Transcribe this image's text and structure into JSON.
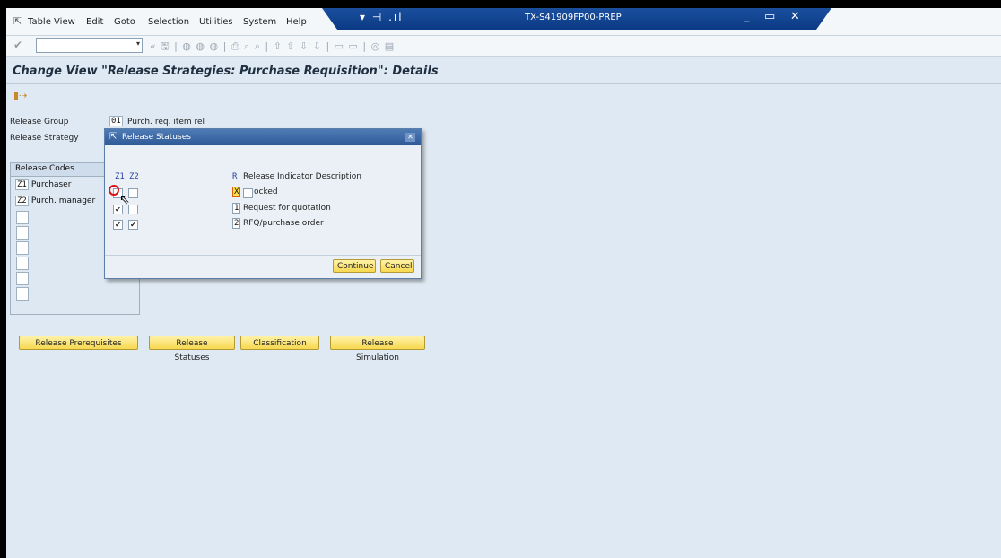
{
  "menubar": {
    "items": [
      "Table View",
      "Edit",
      "Goto",
      "Selection",
      "Utilities",
      "System",
      "Help"
    ],
    "system_name": "TX-S41909FP00-PREP",
    "banner_icons": "▾ ⊣ .ıl",
    "window_controls": "_ ▭ ✕"
  },
  "toolbar": {
    "command_value": "",
    "dropdown_glyph": "▾",
    "icons_glyphs": "« 🖫 | ◍ ◍ ◍ | ⎙ ⌕ ⌕ | ⇧ ⇧ ⇩ ⇩ | ▭ ▭ | ◎ ▤"
  },
  "screen": {
    "title": "Change View \"Release Strategies: Purchase Requisition\": Details"
  },
  "fields": {
    "release_group_label": "Release Group",
    "release_group_code": "01",
    "release_group_text": "Purch. req. item rel",
    "release_strategy_label": "Release Strategy"
  },
  "release_codes": {
    "header": "Release Codes",
    "rows": [
      {
        "code": "Z1",
        "name": "Purchaser"
      },
      {
        "code": "Z2",
        "name": "Purch. manager"
      }
    ]
  },
  "buttons": {
    "release_prerequisites": "Release Prerequisites",
    "release_statuses": "Release Statuses",
    "classification": "Classification",
    "release_simulation": "Release Simulation"
  },
  "dialog": {
    "title": "Release Statuses",
    "col_z1": "Z1",
    "col_z2": "Z2",
    "col_r": "R",
    "desc_header": "Release Indicator Description",
    "rows": [
      {
        "ind": "X",
        "desc": "ocked",
        "z1": "",
        "z2": ""
      },
      {
        "ind": "1",
        "desc": "Request for quotation",
        "z1": "✔",
        "z2": ""
      },
      {
        "ind": "2",
        "desc": "RFQ/purchase order",
        "z1": "✔",
        "z2": "✔"
      }
    ],
    "continue_label": "Continue",
    "cancel_label": "Cancel",
    "close_glyph": "✕"
  }
}
